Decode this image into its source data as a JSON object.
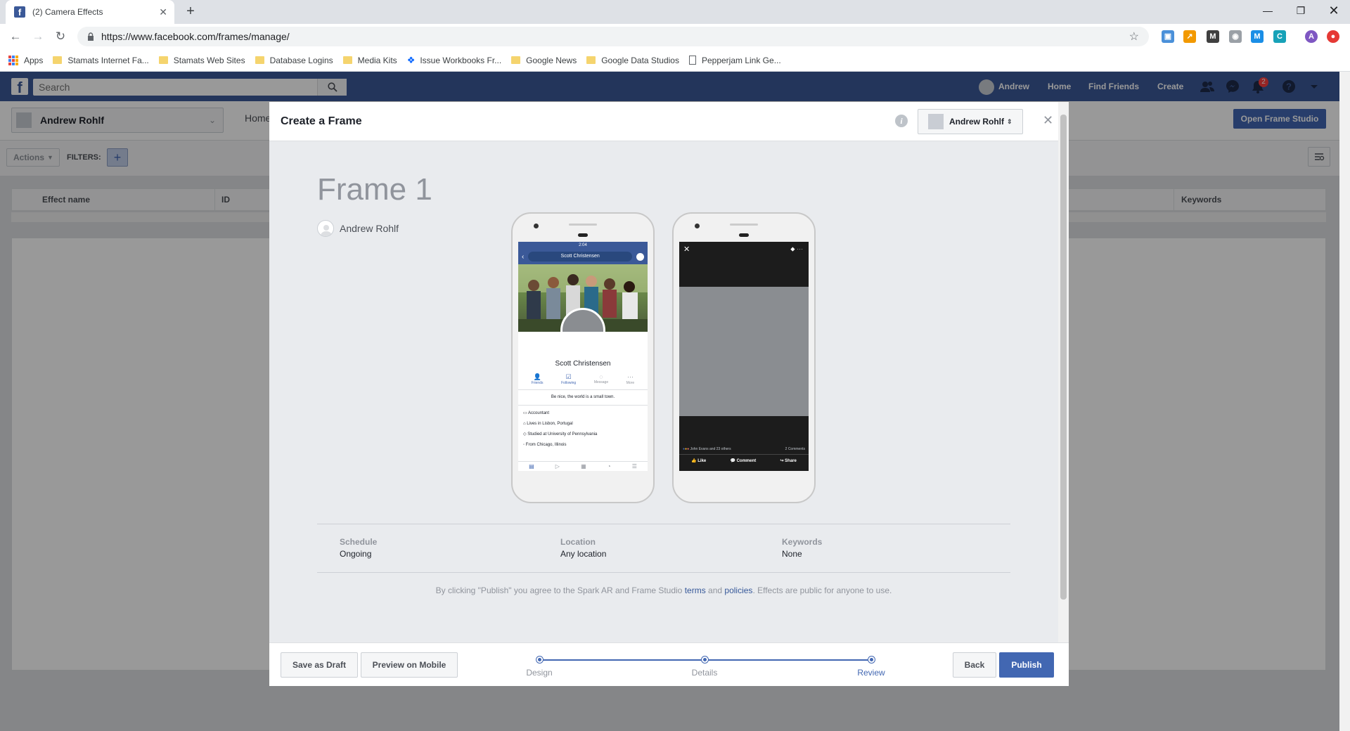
{
  "browser": {
    "tab_title": "(2) Camera Effects",
    "url": "https://www.facebook.com/frames/manage/",
    "bookmarks": [
      "Apps",
      "Stamats Internet Fa...",
      "Stamats Web Sites",
      "Database Logins",
      "Media Kits",
      "Issue Workbooks Fr...",
      "Google News",
      "Google Data Studios",
      "Pepperjam Link Ge..."
    ]
  },
  "fb": {
    "search_placeholder": "Search",
    "user": "Andrew",
    "nav": [
      "Home",
      "Find Friends",
      "Create"
    ],
    "notif_count": "2"
  },
  "page": {
    "account": "Andrew Rohlf",
    "home_link": "Home",
    "open_studio": "Open Frame Studio",
    "actions": "Actions",
    "filters": "FILTERS:",
    "columns": [
      "Effect name",
      "ID",
      "Keywords"
    ]
  },
  "modal": {
    "title": "Create a Frame",
    "owner": "Andrew Rohlf",
    "frame_name": "Frame 1",
    "frame_owner": "Andrew Rohlf",
    "profile_preview": {
      "time": "2:04",
      "search": "Scott Christensen",
      "name": "Scott Christensen",
      "actions": [
        "Friends",
        "Following",
        "Message",
        "More"
      ],
      "bio": "Be nice, the world is a small town.",
      "details": [
        "Accountant",
        "Lives in Lisbon, Portugal",
        "Studied at University of Pennsylvania",
        "From Chicago, Illinois"
      ]
    },
    "post_preview": {
      "reactions": "John Evans and 23 others",
      "comments": "2 Comments",
      "actions": [
        "Like",
        "Comment",
        "Share"
      ]
    },
    "schedule_label": "Schedule",
    "schedule_value": "Ongoing",
    "location_label": "Location",
    "location_value": "Any location",
    "keywords_label": "Keywords",
    "keywords_value": "None",
    "terms_pre": "By clicking \"Publish\" you agree to the Spark AR and Frame Studio ",
    "terms_link1": "terms",
    "terms_mid": " and ",
    "terms_link2": "policies",
    "terms_post": ". Effects are public for anyone to use.",
    "save_draft": "Save as Draft",
    "preview_mobile": "Preview on Mobile",
    "steps": [
      "Design",
      "Details",
      "Review"
    ],
    "back": "Back",
    "publish": "Publish"
  },
  "colors": {
    "fb_blue": "#3b5998",
    "button_blue": "#4267b2",
    "link": "#365899"
  }
}
